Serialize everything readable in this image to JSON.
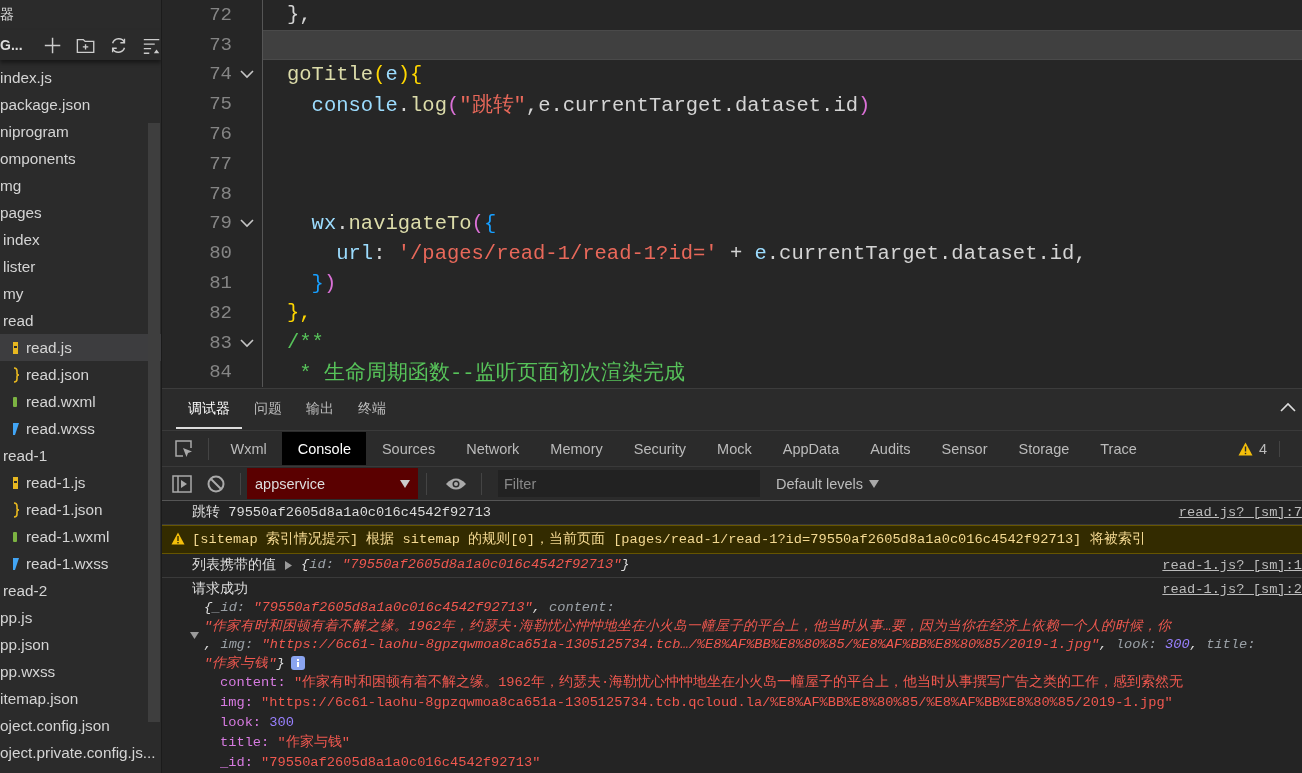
{
  "sidebar": {
    "title": "器",
    "project": "G...",
    "files": [
      {
        "name": "index.js",
        "selected": false
      },
      {
        "name": "package.json",
        "selected": false
      },
      {
        "name": "niprogram",
        "selected": false,
        "children": [
          {
            "name": "omponents",
            "selected": false
          },
          {
            "name": "mg",
            "selected": false
          },
          {
            "name": "pages",
            "selected": false,
            "children": [
              {
                "name": "index",
                "selected": false
              },
              {
                "name": "lister",
                "selected": false
              },
              {
                "name": "my",
                "selected": false
              },
              {
                "name": "read",
                "selected": false,
                "children": [
                  {
                    "name": "read.js",
                    "kind": "js",
                    "selected": true
                  },
                  {
                    "name": "read.json",
                    "kind": "json",
                    "selected": false
                  },
                  {
                    "name": "read.wxml",
                    "kind": "wxml",
                    "selected": false
                  },
                  {
                    "name": "read.wxss",
                    "kind": "wxss",
                    "selected": false
                  }
                ]
              },
              {
                "name": "read-1",
                "selected": false,
                "children": [
                  {
                    "name": "read-1.js",
                    "kind": "js",
                    "selected": false
                  },
                  {
                    "name": "read-1.json",
                    "kind": "json",
                    "selected": false
                  },
                  {
                    "name": "read-1.wxml",
                    "kind": "wxml",
                    "selected": false
                  },
                  {
                    "name": "read-1.wxss",
                    "kind": "wxss",
                    "selected": false
                  }
                ]
              },
              {
                "name": "read-2",
                "selected": false
              }
            ]
          },
          {
            "name": "pp.js",
            "selected": false
          },
          {
            "name": "pp.json",
            "selected": false
          },
          {
            "name": "pp.wxss",
            "selected": false
          }
        ]
      },
      {
        "name": "itemap.json",
        "selected": false
      },
      {
        "name": "oject.config.json",
        "selected": false
      },
      {
        "name": "oject.private.config.js...",
        "selected": false
      }
    ]
  },
  "editor": {
    "lines": [
      {
        "number": "72",
        "fold": false,
        "current": false,
        "tokens": [
          {
            "text": "},",
            "kind": "punct"
          }
        ]
      },
      {
        "number": "73",
        "fold": false,
        "current": true
      },
      {
        "number": "74",
        "fold": true,
        "current": false,
        "tokens": [
          {
            "text": "goTitle",
            "kind": "fn"
          },
          {
            "text": "(",
            "kind": "b1"
          },
          {
            "text": "e",
            "kind": "var"
          },
          {
            "text": ")",
            "kind": "b1"
          },
          {
            "text": "{",
            "kind": "b1"
          }
        ]
      },
      {
        "number": "75",
        "fold": false,
        "current": false,
        "tokens": [
          {
            "text": "  console",
            "kind": "var"
          },
          {
            "text": ".",
            "kind": "punct"
          },
          {
            "text": "log",
            "kind": "fn"
          },
          {
            "text": "(",
            "kind": "b2"
          },
          {
            "text": "\"跳转\"",
            "kind": "str"
          },
          {
            "text": ",e.currentTarget.dataset.id",
            "kind": "punct"
          },
          {
            "text": ")",
            "kind": "b2"
          }
        ]
      },
      {
        "number": "76",
        "fold": false,
        "current": false
      },
      {
        "number": "77",
        "fold": false,
        "current": false
      },
      {
        "number": "78",
        "fold": false,
        "current": false
      },
      {
        "number": "79",
        "fold": true,
        "current": false,
        "tokens": [
          {
            "text": "  wx",
            "kind": "var"
          },
          {
            "text": ".",
            "kind": "punct"
          },
          {
            "text": "navigateTo",
            "kind": "fn"
          },
          {
            "text": "(",
            "kind": "b2"
          },
          {
            "text": "{",
            "kind": "b3"
          }
        ]
      },
      {
        "number": "80",
        "fold": false,
        "current": false,
        "tokens": [
          {
            "text": "    url",
            "kind": "var"
          },
          {
            "text": ": ",
            "kind": "punct"
          },
          {
            "text": "'/pages/read-1/read-1?id='",
            "kind": "str"
          },
          {
            "text": " + ",
            "kind": "punct"
          },
          {
            "text": "e",
            "kind": "var"
          },
          {
            "text": ".currentTarget.dataset.id,",
            "kind": "punct"
          }
        ]
      },
      {
        "number": "81",
        "fold": false,
        "current": false,
        "tokens": [
          {
            "text": "  }",
            "kind": "b3"
          },
          {
            "text": ")",
            "kind": "b2"
          }
        ]
      },
      {
        "number": "82",
        "fold": false,
        "current": false,
        "tokens": [
          {
            "text": "},",
            "kind": "b1"
          }
        ]
      },
      {
        "number": "83",
        "fold": true,
        "current": false,
        "tokens": [
          {
            "text": "/**",
            "kind": "comment"
          }
        ]
      },
      {
        "number": "84",
        "fold": false,
        "current": false,
        "tokens": [
          {
            "text": " * 生命周期函数--监听页面初次渲染完成",
            "kind": "comment"
          }
        ]
      }
    ]
  },
  "devtools": {
    "panel_tabs": [
      {
        "label": "调试器",
        "selected": true
      },
      {
        "label": "问题",
        "selected": false
      },
      {
        "label": "输出",
        "selected": false
      },
      {
        "label": "终端",
        "selected": false
      }
    ],
    "tool_tabs": [
      {
        "label": "Wxml",
        "selected": false
      },
      {
        "label": "Console",
        "selected": true
      },
      {
        "label": "Sources",
        "selected": false
      },
      {
        "label": "Network",
        "selected": false
      },
      {
        "label": "Memory",
        "selected": false
      },
      {
        "label": "Security",
        "selected": false
      },
      {
        "label": "Mock",
        "selected": false
      },
      {
        "label": "AppData",
        "selected": false
      },
      {
        "label": "Audits",
        "selected": false
      },
      {
        "label": "Sensor",
        "selected": false
      },
      {
        "label": "Storage",
        "selected": false
      },
      {
        "label": "Trace",
        "selected": false
      }
    ],
    "warning_count": "4",
    "context": "appservice",
    "filter": {
      "placeholder": "Filter"
    },
    "levels": "Default levels"
  },
  "console": [
    {
      "kind": "log",
      "text": "跳转 79550af2605d8a1a0c016c4542f92713",
      "source": "read.js? [sm]:7"
    },
    {
      "kind": "warning",
      "text": "[sitemap 索引情况提示] 根据 sitemap 的规则[0]，当前页面 [pages/read-1/read-1?id=79550af2605d8a1a0c016c4542f92713] 将被索引"
    },
    {
      "kind": "log",
      "text": "列表携带的值",
      "source": "read-1.js? [sm]:1",
      "object": {
        "expanded": false,
        "preview": [
          [
            {
              "text": "{",
              "kind": "p"
            },
            {
              "text": "id: ",
              "kind": "key"
            },
            {
              "text": "\"79550af2605d8a1a0c016c4542f92713\"",
              "kind": "str"
            },
            {
              "text": "}",
              "kind": "p"
            }
          ]
        ]
      }
    },
    {
      "kind": "log",
      "text": "请求成功",
      "source": "read-1.js? [sm]:2",
      "object": {
        "expanded": true,
        "preview": [
          [
            {
              "text": "{",
              "kind": "p"
            },
            {
              "text": "_id: ",
              "kind": "key"
            },
            {
              "text": "\"79550af2605d8a1a0c016c4542f92713\"",
              "kind": "str"
            },
            {
              "text": ", ",
              "kind": "p"
            },
            {
              "text": "content:",
              "kind": "key"
            }
          ],
          [
            {
              "text": "\"作家有时和困顿有着不解之缘。1962年，约瑟夫·海勒忧心忡忡地坐在小火岛一幢屋子的平台上，他当时从事…要，因为当你在经济上依赖一个人的时候，你",
              "kind": "str"
            }
          ],
          [
            {
              "text": ", ",
              "kind": "p"
            },
            {
              "text": "img: ",
              "kind": "key"
            },
            {
              "text": "\"https://6c61-laohu-8gpzqwmoa8ca651a-1305125734.tcb…/%E8%AF%BB%E8%80%85/%E8%AF%BB%E8%80%85/2019-1.jpg\"",
              "kind": "str"
            },
            {
              "text": ", ",
              "kind": "p"
            },
            {
              "text": "look: ",
              "kind": "key"
            },
            {
              "text": "300",
              "kind": "num"
            },
            {
              "text": ", ",
              "kind": "p"
            },
            {
              "text": "title:",
              "kind": "key"
            }
          ],
          [
            {
              "text": "\"作家与钱\"",
              "kind": "str"
            },
            {
              "text": "}",
              "kind": "p"
            }
          ]
        ],
        "properties": [
          {
            "key": "content:",
            "value": "\"作家有时和困顿有着不解之缘。1962年，约瑟夫·海勒忧心忡忡地坐在小火岛一幢屋子的平台上，他当时从事撰写广告之类的工作，感到索然无",
            "kind": "str"
          },
          {
            "key": "img:",
            "value": "\"https://6c61-laohu-8gpzqwmoa8ca651a-1305125734.tcb.qcloud.la/%E8%AF%BB%E8%80%85/%E8%AF%BB%E8%80%85/2019-1.jpg\"",
            "kind": "str"
          },
          {
            "key": "look:",
            "value": "300",
            "kind": "num"
          },
          {
            "key": "title:",
            "value": "\"作家与钱\"",
            "kind": "str"
          },
          {
            "key": "_id:",
            "value": "\"79550af2605d8a1a0c016c4542f92713\"",
            "kind": "str"
          }
        ]
      }
    }
  ]
}
